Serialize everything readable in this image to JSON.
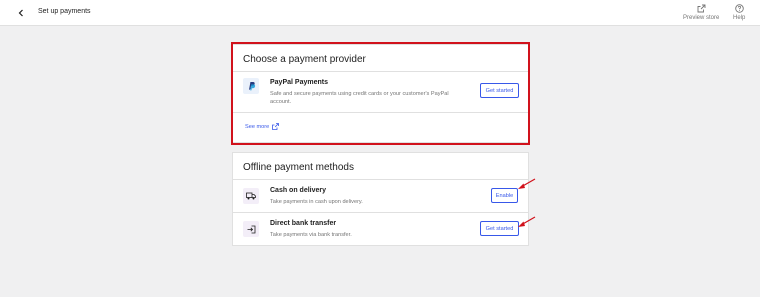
{
  "header": {
    "title": "Set up payments",
    "preview_label": "Preview store",
    "help_label": "Help"
  },
  "provider_card": {
    "title": "Choose a payment provider",
    "provider": {
      "name": "PayPal Payments",
      "description": "Safe and secure payments using credit cards or your customer's PayPal account.",
      "button_label": "Get started"
    },
    "see_more_label": "See more"
  },
  "offline_card": {
    "title": "Offline payment methods",
    "methods": [
      {
        "name": "Cash on delivery",
        "description": "Take payments in cash upon delivery.",
        "button_label": "Enable"
      },
      {
        "name": "Direct bank transfer",
        "description": "Take payments via bank transfer.",
        "button_label": "Get started"
      }
    ]
  },
  "colors": {
    "accent": "#3858e9",
    "annotation": "#d1121c",
    "background": "#f0f0f1"
  },
  "icons": [
    "chevron-left-icon",
    "external-link-icon",
    "help-circle-icon",
    "paypal-logo-icon",
    "truck-icon",
    "bank-transfer-icon"
  ]
}
